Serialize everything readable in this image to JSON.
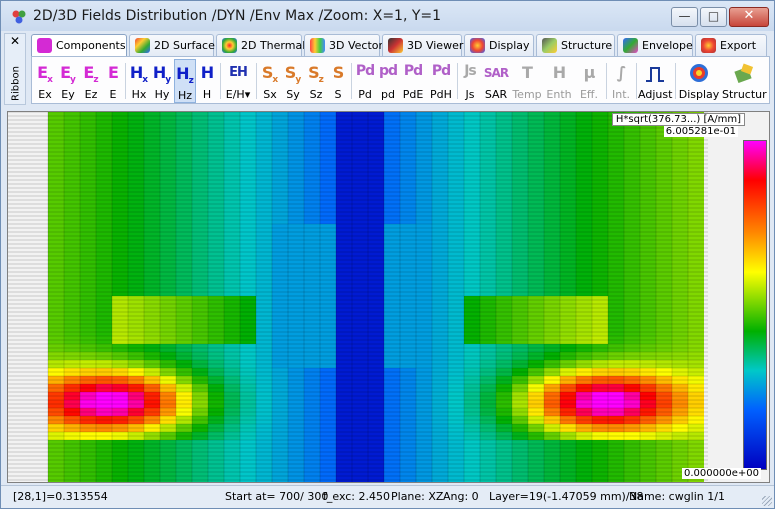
{
  "window": {
    "title": "2D/3D Fields Distribution /DYN /Env Max /Zoom: X=1, Y=1",
    "minimize_glyph": "—",
    "maximize_glyph": "□",
    "close_glyph": "✕"
  },
  "ribbon_side": {
    "close_glyph": "✕",
    "label": "Ribbon"
  },
  "tabs": [
    {
      "label": "Components",
      "icon": "components-icon"
    },
    {
      "label": "2D Surface",
      "icon": "surface-icon"
    },
    {
      "label": "2D Thermal",
      "icon": "thermal-icon"
    },
    {
      "label": "3D Vector",
      "icon": "vector-icon"
    },
    {
      "label": "3D Viewer",
      "icon": "viewer-icon"
    },
    {
      "label": "Display",
      "icon": "display-icon"
    },
    {
      "label": "Structure",
      "icon": "structure-icon"
    },
    {
      "label": "Envelope",
      "icon": "envelope-icon"
    },
    {
      "label": "Export",
      "icon": "export-icon"
    }
  ],
  "ribbon_buttons": [
    {
      "big": "Ex",
      "label": "Ex"
    },
    {
      "big": "Ey",
      "label": "Ey"
    },
    {
      "big": "Ez",
      "label": "Ez"
    },
    {
      "big": "E",
      "label": "E"
    },
    {
      "big": "Hx",
      "label": "Hx"
    },
    {
      "big": "Hy",
      "label": "Hy"
    },
    {
      "big": "Hz",
      "label": "Hz"
    },
    {
      "big": "H",
      "label": "H"
    },
    {
      "big": "EH",
      "label": "E/H▾"
    },
    {
      "big": "Sx",
      "label": "Sx"
    },
    {
      "big": "Sy",
      "label": "Sy"
    },
    {
      "big": "Sz",
      "label": "Sz"
    },
    {
      "big": "S",
      "label": "S"
    },
    {
      "big": "Pd",
      "label": "Pd"
    },
    {
      "big": "pd",
      "label": "pd"
    },
    {
      "big": "Pd",
      "label": "PdE"
    },
    {
      "big": "Pd",
      "label": "PdH"
    },
    {
      "big": "Js",
      "label": "Js"
    },
    {
      "big": "SAR",
      "label": "SAR"
    },
    {
      "big": "T",
      "label": "Temp"
    },
    {
      "big": "H",
      "label": "Enth"
    },
    {
      "big": "μ",
      "label": "Eff."
    },
    {
      "big": "∫",
      "label": "Int."
    },
    {
      "big": "⎍",
      "label": "Adjust"
    },
    {
      "big": "◉",
      "label": "Display"
    },
    {
      "big": "⚒",
      "label": "Structur"
    }
  ],
  "legend": {
    "caption": "H*sqrt(376.73...) [A/mm]",
    "max_label": "6.005281e-01",
    "min_label": "0.000000e+00"
  },
  "status": {
    "cell": "[28,1]=0.313554",
    "start": "Start at= 700/ 300",
    "fexc": "f_exc:  2.450",
    "plane": "Plane: XZ",
    "ang": "Ang:   0",
    "layer": "Layer=19(-1.47059 mm)/38",
    "name": "Name: cwglin 1/1"
  },
  "colors": {
    "accent": "#1020c8",
    "selected_tab_bg": "#cfe0f6"
  }
}
